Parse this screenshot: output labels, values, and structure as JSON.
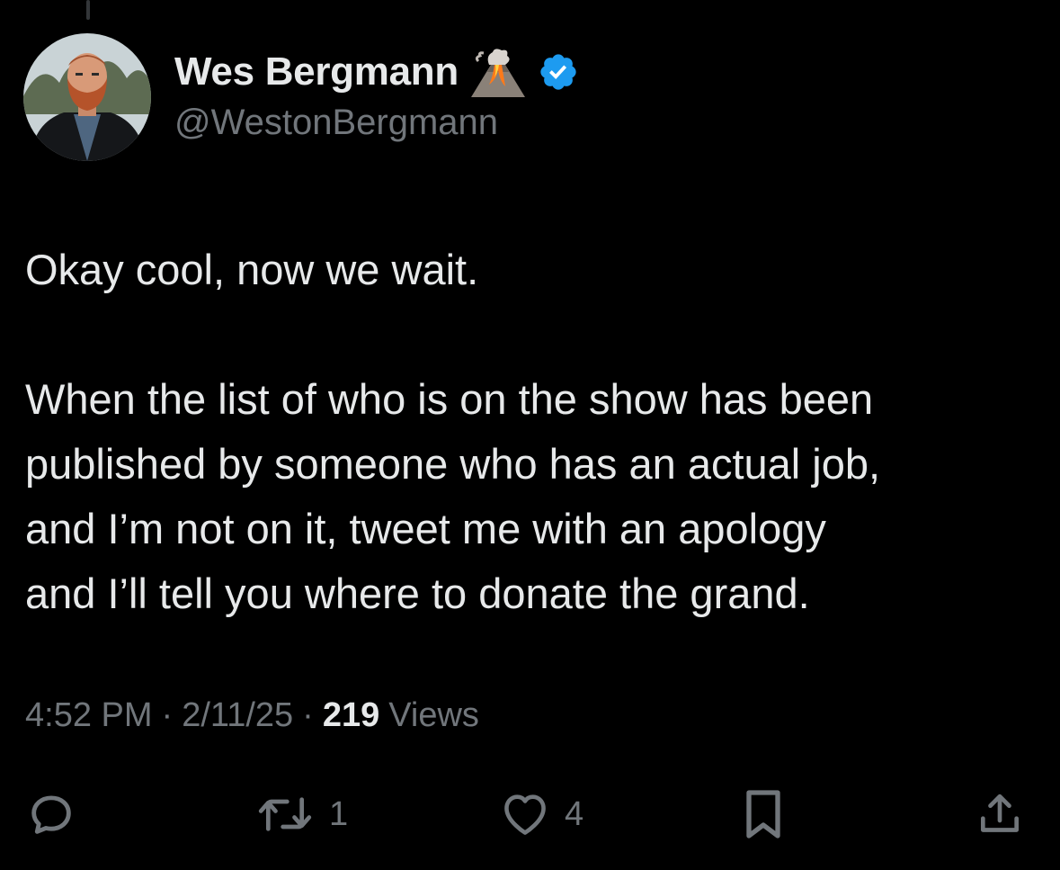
{
  "author": {
    "display_name": "Wes Bergmann",
    "handle": "@WestonBergmann",
    "badge_emoji": "volcano-icon",
    "verified": true,
    "verified_color": "#1d9bf0"
  },
  "tweet": {
    "paragraphs": [
      [
        "Okay cool, now we wait."
      ],
      [
        "When the list of who is on the show has been",
        "published by someone who has an actual job,",
        "and I’m not on it, tweet me with an apology",
        "and I’ll tell you where to donate the grand."
      ]
    ]
  },
  "meta": {
    "time": "4:52 PM",
    "separator": "·",
    "date": "2/11/25",
    "views_count": "219",
    "views_label": "Views"
  },
  "actions": {
    "reply_icon": "reply-icon",
    "retweet_icon": "retweet-icon",
    "retweet_count": "1",
    "like_icon": "heart-icon",
    "like_count": "4",
    "bookmark_icon": "bookmark-icon",
    "share_icon": "share-icon"
  },
  "colors": {
    "background": "#000000",
    "primary_text": "#e7e9ea",
    "secondary_text": "#71767b"
  }
}
